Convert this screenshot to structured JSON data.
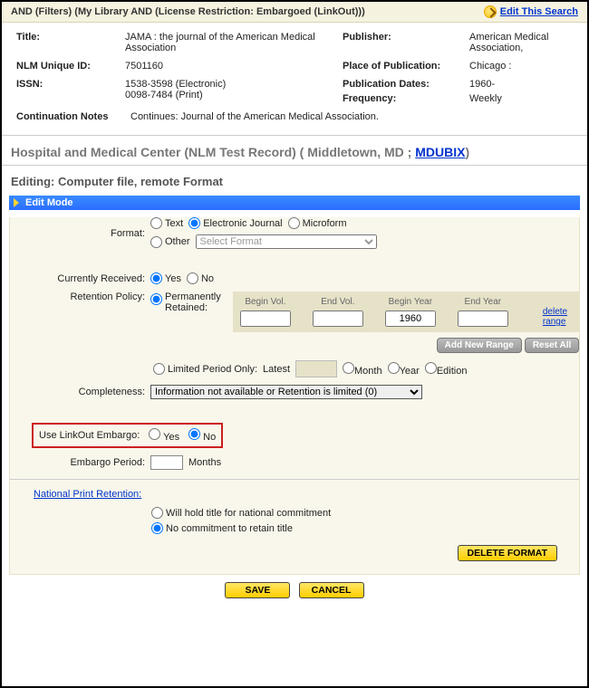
{
  "filter_line": "AND (Filters) (My Library AND (License Restriction: Embargoed (LinkOut)))",
  "edit_search": "Edit This Search",
  "record": {
    "title_lbl": "Title:",
    "title_val": "JAMA : the journal of the American Medical Association",
    "nlm_lbl": "NLM Unique ID:",
    "nlm_val": "7501160",
    "issn_lbl": "ISSN:",
    "issn_val1": "1538-3598 (Electronic)",
    "issn_val2": "0098-7484 (Print)",
    "cont_lbl": "Continuation Notes",
    "cont_val": "Continues: Journal of the American Medical Association.",
    "pub_lbl": "Publisher:",
    "pub_val": "American Medical Association,",
    "pop_lbl": "Place of Publication:",
    "pop_val": "Chicago :",
    "dates_lbl": "Publication Dates:",
    "dates_val": "1960-",
    "freq_lbl": "Frequency:",
    "freq_val": "Weekly"
  },
  "org_line_pre": "Hospital and Medical Center (NLM Test Record) ( Middletown, MD ; ",
  "org_code": "MDUBIX",
  "org_line_post": ")",
  "editing_line": "Editing: Computer file, remote Format",
  "edit_mode": "Edit Mode",
  "format": {
    "label": "Format:",
    "text": "Text",
    "ej": "Electronic Journal",
    "micro": "Microform",
    "other": "Other",
    "other_ph": "Select Format"
  },
  "curr_recv": {
    "label": "Currently Received:",
    "yes": "Yes",
    "no": "No"
  },
  "ret_pol": {
    "label": "Retention Policy:",
    "perm": "Permanently Retained:",
    "cols": {
      "bv": "Begin Vol.",
      "ev": "End Vol.",
      "by": "Begin Year",
      "ey": "End Year"
    },
    "begin_year_val": "1960",
    "delete_range": "delete range",
    "add": "Add New Range",
    "reset": "Reset All",
    "limited": "Limited Period Only:",
    "latest": "Latest",
    "month": "Month",
    "year": "Year",
    "edition": "Edition"
  },
  "completeness": {
    "label": "Completeness:",
    "val": "Information not available or Retention is limited (0)"
  },
  "embargo": {
    "label": "Use LinkOut Embargo:",
    "yes": "Yes",
    "no": "No",
    "period_label": "Embargo Period:",
    "unit": "Months"
  },
  "npr": {
    "link": "National Print Retention:",
    "hold": "Will hold title for national commitment",
    "noc": "No commitment to retain title"
  },
  "buttons": {
    "del_fmt": "DELETE FORMAT",
    "save": "SAVE",
    "cancel": "CANCEL"
  }
}
